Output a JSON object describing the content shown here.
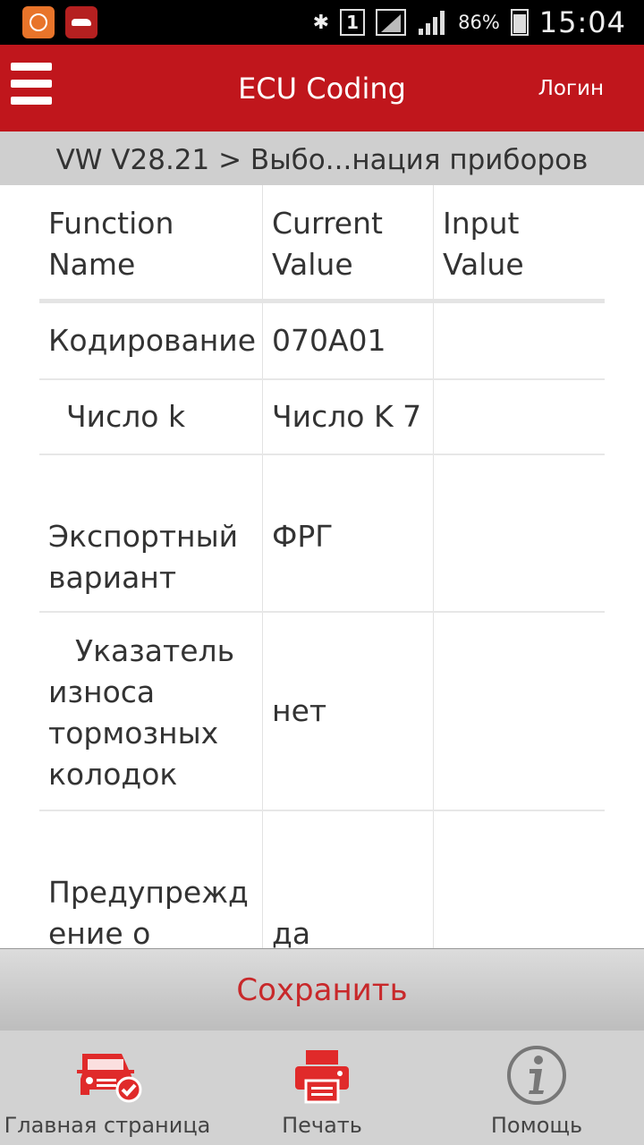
{
  "status_bar": {
    "battery": "86%",
    "time": "15:04",
    "sim_label": "1"
  },
  "header": {
    "title": "ECU Coding",
    "login": "Логин"
  },
  "breadcrumb": "VW V28.21 > Выбо...нация приборов",
  "table": {
    "columns": [
      "Function Name",
      "Current Value",
      "Input Value"
    ],
    "rows": [
      {
        "name": "Кодирование",
        "current": "070A01",
        "input": ""
      },
      {
        "name": "Число k",
        "current": "Число K 7",
        "input": ""
      },
      {
        "name": "Экспортный вариант",
        "current": "ФРГ",
        "input": ""
      },
      {
        "name": "Указатель износа тормозных колодок",
        "current": "нет",
        "input": ""
      },
      {
        "name": "Предупреждение о",
        "current": "да",
        "input": ""
      }
    ]
  },
  "save_button": "Сохранить",
  "bottom_nav": {
    "items": [
      {
        "label": "Главная страница",
        "icon": "car-check-icon"
      },
      {
        "label": "Печать",
        "icon": "printer-icon"
      },
      {
        "label": "Помощь",
        "icon": "info-icon"
      }
    ]
  },
  "colors": {
    "accent": "#c0161c",
    "breadcrumb_bg": "#cfcfcf",
    "nav_bg": "#d2d2d2"
  }
}
